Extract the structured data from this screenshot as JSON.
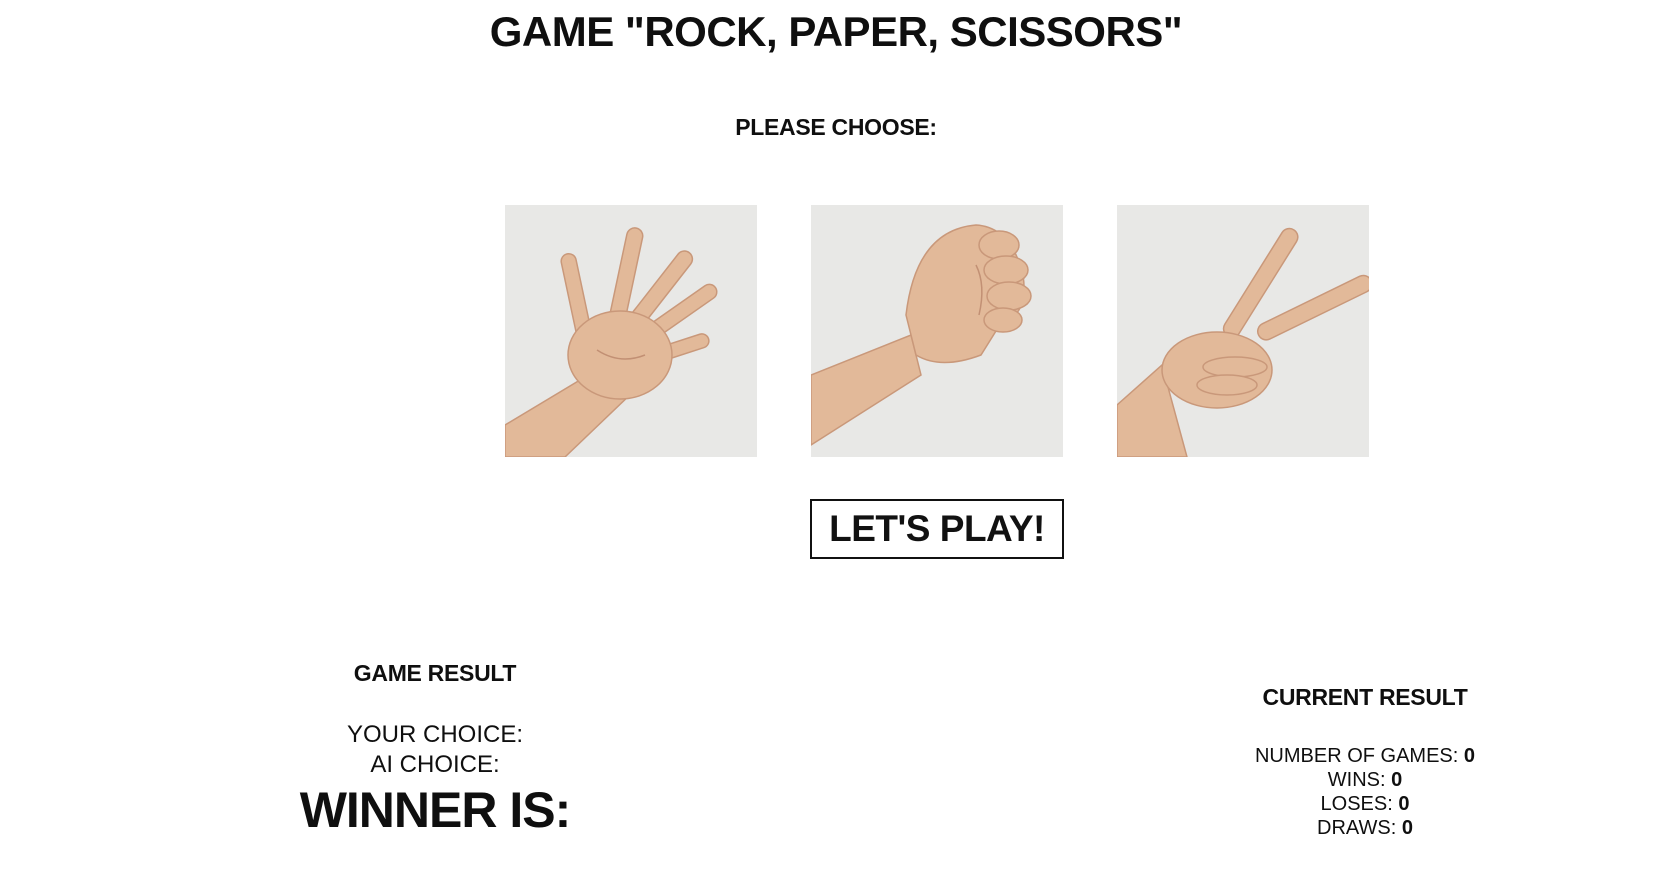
{
  "title": "GAME \"ROCK, PAPER, SCISSORS\"",
  "choose_label": "PLEASE CHOOSE:",
  "options": [
    {
      "id": "paper",
      "icon": "open-hand-icon"
    },
    {
      "id": "rock",
      "icon": "fist-icon"
    },
    {
      "id": "scissors",
      "icon": "victory-hand-icon"
    }
  ],
  "play_button_label": "LET'S PLAY!",
  "game_result": {
    "heading": "GAME RESULT",
    "your_choice_label": "YOUR CHOICE:",
    "ai_choice_label": "AI CHOICE:",
    "winner_label": "WINNER IS:"
  },
  "current_result": {
    "heading": "CURRENT RESULT",
    "games_label": "NUMBER OF GAMES:",
    "games_value": "0",
    "wins_label": "WINS:",
    "wins_value": "0",
    "loses_label": "LOSES:",
    "loses_value": "0",
    "draws_label": "DRAWS:",
    "draws_value": "0"
  },
  "colors": {
    "text": "#0f0f0f",
    "background": "#ffffff",
    "photo_background": "#e8e8e6",
    "skin": "#e2b999"
  }
}
